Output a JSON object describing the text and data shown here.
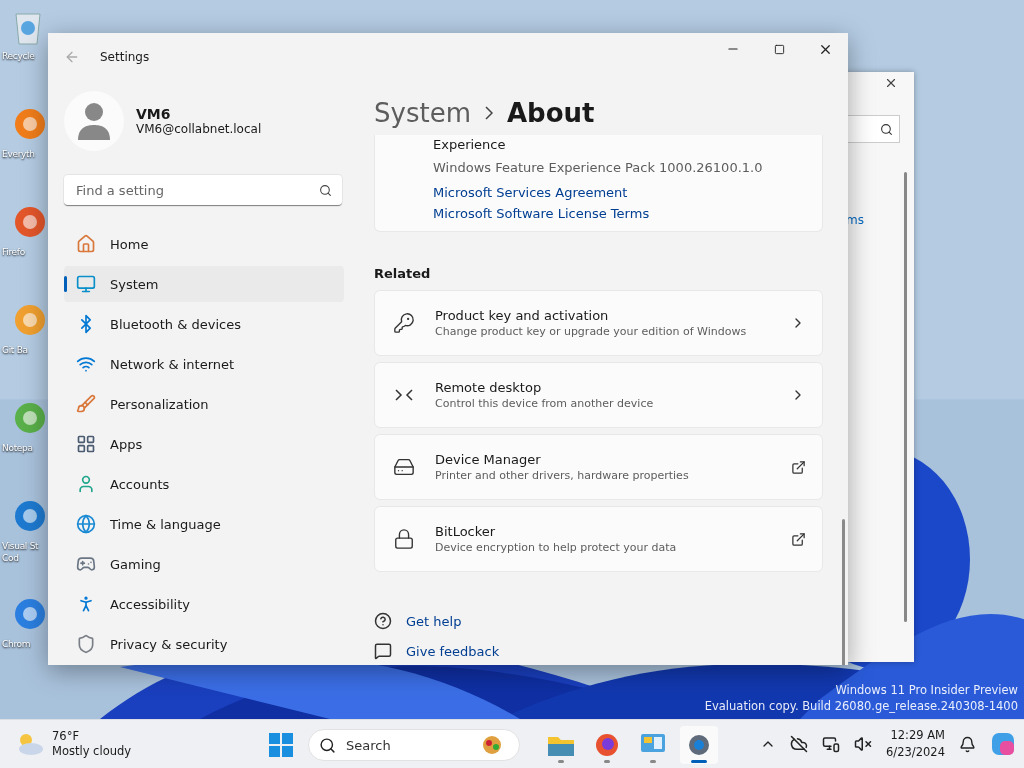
{
  "desktop_icons": [
    {
      "label": "Recycle"
    },
    {
      "label": "Everyth"
    },
    {
      "label": "Firefo"
    },
    {
      "label": "Git Ba"
    },
    {
      "label": "Notepa"
    },
    {
      "label": "Visual St Cod"
    },
    {
      "label": "Chrom"
    }
  ],
  "background_window": {
    "link": "ms"
  },
  "watermark": {
    "line_1": "Windows 11 Pro Insider Preview",
    "line_2": "Evaluation copy. Build 26080.ge_release.240308-1400"
  },
  "window": {
    "title": "Settings"
  },
  "profile": {
    "name": "VM6",
    "email": "VM6@collabnet.local"
  },
  "search": {
    "placeholder": "Find a setting"
  },
  "sidebar": {
    "items": [
      {
        "label": "Home",
        "selected": false
      },
      {
        "label": "System",
        "selected": true
      },
      {
        "label": "Bluetooth & devices",
        "selected": false
      },
      {
        "label": "Network & internet",
        "selected": false
      },
      {
        "label": "Personalization",
        "selected": false
      },
      {
        "label": "Apps",
        "selected": false
      },
      {
        "label": "Accounts",
        "selected": false
      },
      {
        "label": "Time & language",
        "selected": false
      },
      {
        "label": "Gaming",
        "selected": false
      },
      {
        "label": "Accessibility",
        "selected": false
      },
      {
        "label": "Privacy & security",
        "selected": false
      }
    ]
  },
  "breadcrumb": {
    "parent": "System",
    "current": "About"
  },
  "spec_card": {
    "label": "Experience",
    "value": "Windows Feature Experience Pack 1000.26100.1.0",
    "links": [
      "Microsoft Services Agreement",
      "Microsoft Software License Terms"
    ]
  },
  "related": {
    "heading": "Related",
    "items": [
      {
        "title": "Product key and activation",
        "subtitle": "Change product key or upgrade your edition of Windows",
        "kind": "chevron"
      },
      {
        "title": "Remote desktop",
        "subtitle": "Control this device from another device",
        "kind": "chevron"
      },
      {
        "title": "Device Manager",
        "subtitle": "Printer and other drivers, hardware properties",
        "kind": "external"
      },
      {
        "title": "BitLocker",
        "subtitle": "Device encryption to help protect your data",
        "kind": "external"
      }
    ]
  },
  "help_links": [
    "Get help",
    "Give feedback"
  ],
  "taskbar": {
    "weather": {
      "temperature": "76°F",
      "condition": "Mostly cloudy"
    },
    "search": {
      "placeholder": "Search"
    },
    "apps": [
      {
        "selected": false
      },
      {
        "selected": false
      },
      {
        "selected": false
      },
      {
        "selected": true
      }
    ],
    "time": "12:29 AM",
    "date": "6/23/2024"
  }
}
